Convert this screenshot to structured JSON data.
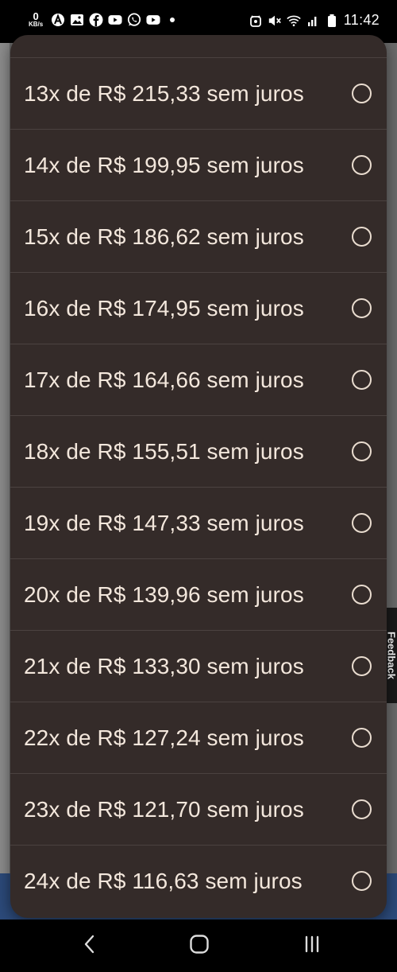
{
  "status_bar": {
    "data_speed_value": "0",
    "data_speed_unit": "KB/s",
    "time": "11:42",
    "left_icons": [
      "autopilot-a-icon",
      "gallery-icon",
      "facebook-icon",
      "youtube-icon",
      "whatsapp-icon",
      "youtube-icon",
      "notification-dot"
    ],
    "right_icons": [
      "alarm-icon",
      "mute-icon",
      "wifi-icon",
      "signal-icon",
      "battery-icon"
    ]
  },
  "background": {
    "feedback_label": "Feedback"
  },
  "installments": {
    "options": [
      {
        "label": "13x de R$ 215,33 sem juros",
        "selected": false
      },
      {
        "label": "14x de R$ 199,95 sem juros",
        "selected": false
      },
      {
        "label": "15x de R$ 186,62 sem juros",
        "selected": false
      },
      {
        "label": "16x de R$ 174,95 sem juros",
        "selected": false
      },
      {
        "label": "17x de R$ 164,66 sem juros",
        "selected": false
      },
      {
        "label": "18x de R$ 155,51 sem juros",
        "selected": false
      },
      {
        "label": "19x de R$ 147,33 sem juros",
        "selected": false
      },
      {
        "label": "20x de R$ 139,96 sem juros",
        "selected": false
      },
      {
        "label": "21x de R$ 133,30 sem juros",
        "selected": false
      },
      {
        "label": "22x de R$ 127,24 sem juros",
        "selected": false
      },
      {
        "label": "23x de R$ 121,70 sem juros",
        "selected": false
      },
      {
        "label": "24x de R$ 116,63 sem juros",
        "selected": false
      }
    ]
  },
  "nav": {
    "buttons": [
      "back-icon",
      "home-icon",
      "recents-icon"
    ]
  },
  "colors": {
    "sheet_bg": "#342b29",
    "text": "#f3e7dc",
    "divider": "#4b4240",
    "radio": "#e9dccf"
  }
}
